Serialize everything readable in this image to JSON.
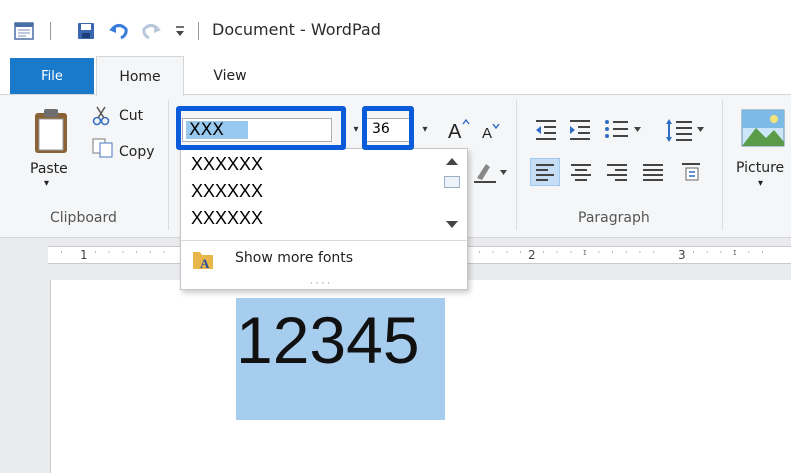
{
  "window": {
    "title": "Document - WordPad"
  },
  "tabs": {
    "file": "File",
    "home": "Home",
    "view": "View"
  },
  "clipboard": {
    "paste": "Paste",
    "cut": "Cut",
    "copy": "Copy",
    "group_label": "Clipboard"
  },
  "font": {
    "name_value": "XXX",
    "size_value": "36",
    "dropdown_items": [
      "XXXXXX",
      "XXXXXX",
      "XXXXXX"
    ],
    "show_more": "Show more fonts"
  },
  "paragraph": {
    "group_label": "Paragraph"
  },
  "insert": {
    "picture": "Picture"
  },
  "ruler": {
    "marks": [
      "1",
      "2",
      "3"
    ]
  },
  "document": {
    "text": "12345"
  },
  "colors": {
    "accent": "#1979ca",
    "highlight": "#0a5bd9",
    "selection": "#a7cdee"
  }
}
